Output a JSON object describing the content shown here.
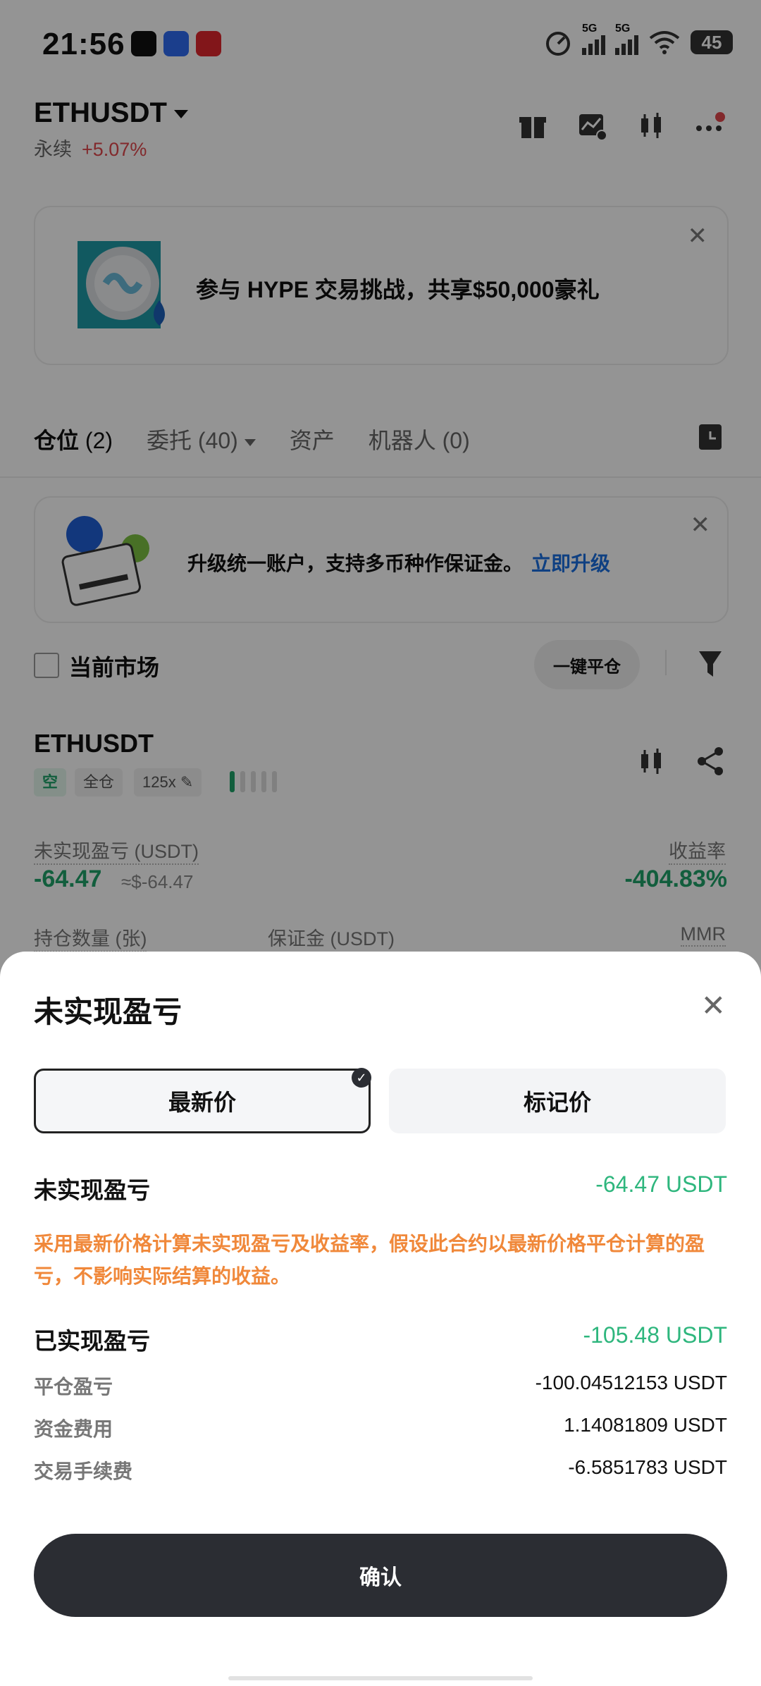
{
  "status_bar": {
    "time": "21:56",
    "signal_1": "5G",
    "signal_2": "5G",
    "battery": "45"
  },
  "header": {
    "symbol": "ETHUSDT",
    "contract_type": "永续",
    "change": "+5.07%"
  },
  "banner": {
    "text": "参与 HYPE 交易挑战，共享$50,000豪礼"
  },
  "tabs": [
    {
      "label": "仓位",
      "count": "(2)"
    },
    {
      "label": "委托",
      "count": "(40)"
    },
    {
      "label": "资产",
      "count": ""
    },
    {
      "label": "机器人",
      "count": "(0)"
    }
  ],
  "upgrade": {
    "text": "升级统一账户，支持多币种作保证金。",
    "link": "立即升级"
  },
  "filter": {
    "current_market": "当前市场",
    "close_all": "一键平仓"
  },
  "position": {
    "symbol": "ETHUSDT",
    "side": "空",
    "margin_mode": "全仓",
    "leverage": "125x",
    "unrealized_label": "未实现盈亏",
    "unrealized_unit": "(USDT)",
    "unrealized_value": "-64.47",
    "unrealized_usd": "≈$-64.47",
    "roi_label": "收益率",
    "roi_value": "-404.83%",
    "qty_label": "持仓数量 (张)",
    "margin_label": "保证金",
    "margin_unit": "(USDT)",
    "mmr_label": "MMR"
  },
  "sheet": {
    "title": "未实现盈亏",
    "seg_latest": "最新价",
    "seg_mark": "标记价",
    "unrealized_label": "未实现盈亏",
    "unrealized_value": "-64.47 USDT",
    "note": "采用最新价格计算未实现盈亏及收益率，假设此合约以最新价格平仓计算的盈亏，不影响实际结算的收益。",
    "realized_label": "已实现盈亏",
    "realized_value": "-105.48 USDT",
    "details": [
      {
        "label": "平仓盈亏",
        "value": "-100.04512153 USDT"
      },
      {
        "label": "资金费用",
        "value": "1.14081809 USDT"
      },
      {
        "label": "交易手续费",
        "value": "-6.5851783 USDT"
      }
    ],
    "confirm": "确认"
  }
}
